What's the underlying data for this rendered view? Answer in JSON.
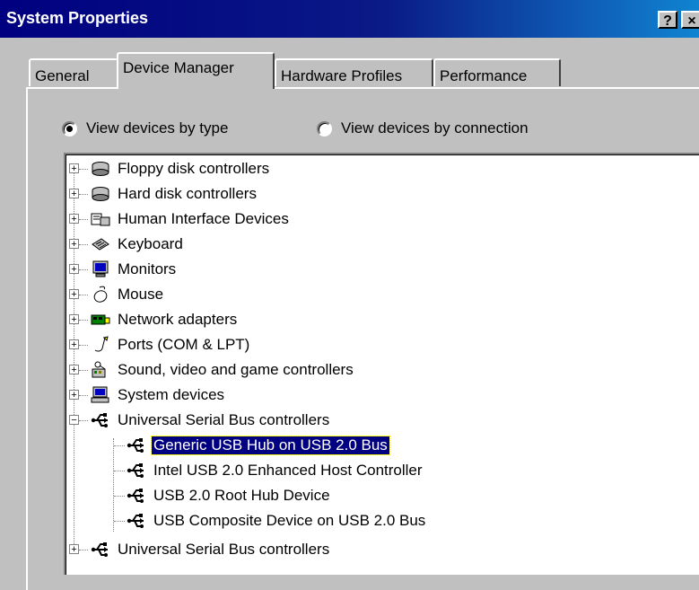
{
  "window": {
    "title": "System Properties",
    "help_label": "?",
    "close_label": "×"
  },
  "tabs": [
    {
      "label": "General",
      "active": false
    },
    {
      "label": "Device Manager",
      "active": true
    },
    {
      "label": "Hardware Profiles",
      "active": false
    },
    {
      "label": "Performance",
      "active": false
    }
  ],
  "view_options": {
    "by_type": {
      "label": "View devices by type",
      "selected": true
    },
    "by_connection": {
      "label": "View devices by connection",
      "selected": false
    }
  },
  "tree": {
    "categories": [
      {
        "label": "Floppy disk controllers",
        "icon": "floppy-controller-icon"
      },
      {
        "label": "Hard disk controllers",
        "icon": "hard-disk-controller-icon"
      },
      {
        "label": "Human Interface Devices",
        "icon": "hid-icon"
      },
      {
        "label": "Keyboard",
        "icon": "keyboard-icon"
      },
      {
        "label": "Monitors",
        "icon": "monitor-icon"
      },
      {
        "label": "Mouse",
        "icon": "mouse-icon"
      },
      {
        "label": "Network adapters",
        "icon": "network-adapter-icon"
      },
      {
        "label": "Ports (COM & LPT)",
        "icon": "port-icon"
      },
      {
        "label": "Sound, video and game controllers",
        "icon": "sound-icon"
      },
      {
        "label": "System devices",
        "icon": "system-devices-icon"
      },
      {
        "label": "Universal Serial Bus controllers",
        "icon": "usb-icon",
        "expanded": true
      }
    ],
    "usb_children": [
      {
        "label": "Generic USB Hub on USB 2.0 Bus",
        "icon": "usb-icon",
        "selected": true
      },
      {
        "label": "Intel USB 2.0 Enhanced Host Controller",
        "icon": "usb-icon"
      },
      {
        "label": "USB 2.0 Root Hub Device",
        "icon": "usb-icon"
      },
      {
        "label": "USB Composite Device on USB 2.0 Bus",
        "icon": "usb-icon"
      }
    ],
    "last_category": {
      "label": "Universal Serial Bus controllers",
      "icon": "usb-icon"
    }
  },
  "colors": {
    "title_bar_start": "#000080",
    "title_bar_end": "#1084d0",
    "selection": "#000080",
    "face": "#c0c0c0"
  }
}
